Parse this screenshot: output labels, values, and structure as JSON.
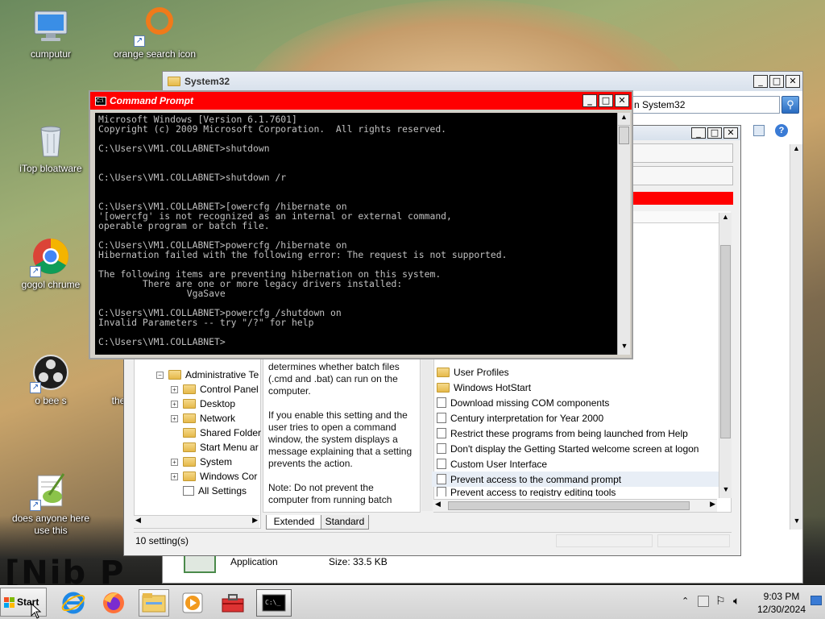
{
  "desktop": {
    "icons": [
      {
        "label": "cumputur"
      },
      {
        "label": "orange search icon"
      },
      {
        "label": "iTop bloatware"
      },
      {
        "label": "gogol chrume"
      },
      {
        "label": "o bee s"
      },
      {
        "label": "the"
      },
      {
        "label": "does anyone here use this"
      }
    ],
    "wallpaper_text": "[Nib P"
  },
  "explorer": {
    "title": "System32",
    "search_placeholder": "n System32",
    "footer_name": "Application",
    "footer_size": "Size: 33.5 KB"
  },
  "gpedit": {
    "tree": [
      {
        "label": "Administrative Te",
        "expander": "−",
        "indent": 0
      },
      {
        "label": "Control Panel",
        "expander": "+",
        "indent": 1
      },
      {
        "label": "Desktop",
        "expander": "+",
        "indent": 1
      },
      {
        "label": "Network",
        "expander": "+",
        "indent": 1
      },
      {
        "label": "Shared Folder",
        "expander": "",
        "indent": 1
      },
      {
        "label": "Start Menu ar",
        "expander": "",
        "indent": 1
      },
      {
        "label": "System",
        "expander": "+",
        "indent": 1
      },
      {
        "label": "Windows Cor",
        "expander": "+",
        "indent": 1
      },
      {
        "label": "All Settings",
        "expander": "",
        "indent": 1
      }
    ],
    "description": "determines whether batch files (.cmd and .bat) can run on the computer.\n\nIf you enable this setting and the user tries to open a command window, the system displays a message explaining that a setting prevents the action.\n\nNote: Do not prevent the computer from running batch",
    "settings": [
      {
        "label": "User Profiles",
        "kind": "folder"
      },
      {
        "label": "Windows HotStart",
        "kind": "folder"
      },
      {
        "label": "Download missing COM components",
        "kind": "policy"
      },
      {
        "label": "Century interpretation for Year 2000",
        "kind": "policy"
      },
      {
        "label": "Restrict these programs from being launched from Help",
        "kind": "policy"
      },
      {
        "label": "Don't display the Getting Started welcome screen at logon",
        "kind": "policy"
      },
      {
        "label": "Custom User Interface",
        "kind": "policy"
      },
      {
        "label": "Prevent access to the command prompt",
        "kind": "policy",
        "selected": true
      },
      {
        "label": "Prevent access to registry editing tools",
        "kind": "policy"
      }
    ],
    "tabs": [
      "Extended",
      "Standard"
    ],
    "status": "10 setting(s)"
  },
  "cmd": {
    "title": "Command Prompt",
    "lines": [
      "Microsoft Windows [Version 6.1.7601]",
      "Copyright (c) 2009 Microsoft Corporation.  All rights reserved.",
      "",
      "C:\\Users\\VM1.COLLABNET>shutdown",
      "",
      "",
      "C:\\Users\\VM1.COLLABNET>shutdown /r",
      "",
      "",
      "C:\\Users\\VM1.COLLABNET>[owercfg /hibernate on",
      "'[owercfg' is not recognized as an internal or external command,",
      "operable program or batch file.",
      "",
      "C:\\Users\\VM1.COLLABNET>powercfg /hibernate on",
      "Hibernation failed with the following error: The request is not supported.",
      "",
      "The following items are preventing hibernation on this system.",
      "        There are one or more legacy drivers installed:",
      "                VgaSave",
      "",
      "C:\\Users\\VM1.COLLABNET>powercfg /shutdown on",
      "Invalid Parameters -- try \"/?\" for help",
      "",
      "C:\\Users\\VM1.COLLABNET>"
    ]
  },
  "taskbar": {
    "start_label": "Start",
    "time": "9:03 PM",
    "date": "12/30/2024"
  }
}
